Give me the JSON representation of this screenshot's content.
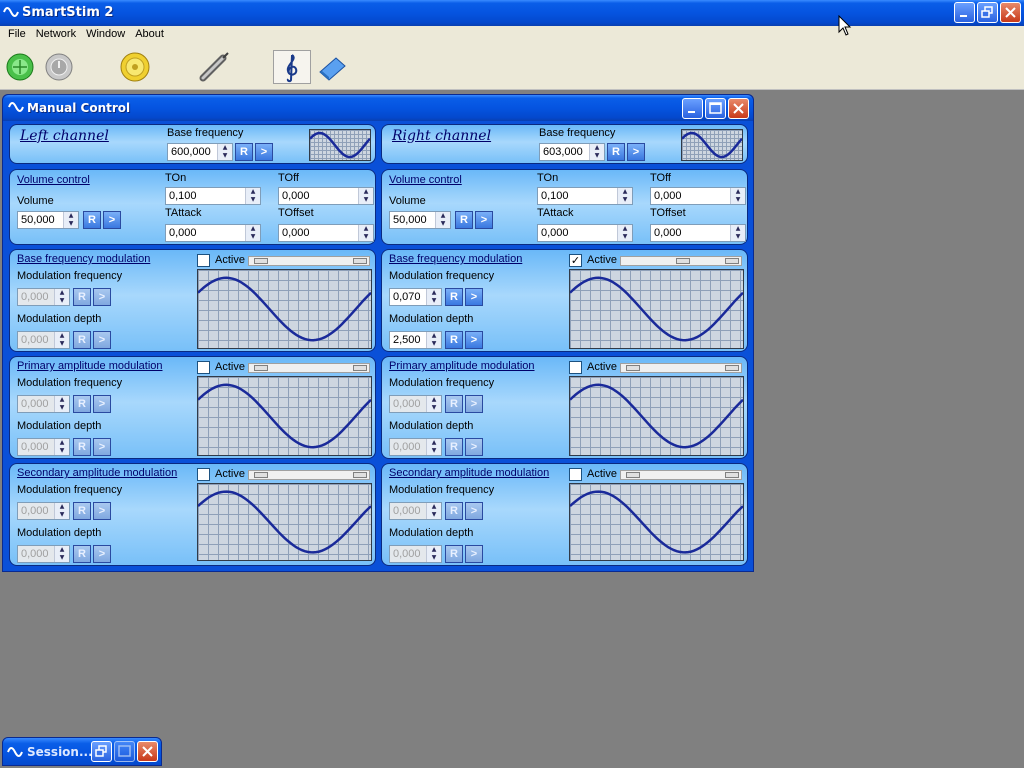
{
  "app": {
    "title": "SmartStim 2"
  },
  "menu": [
    "File",
    "Network",
    "Window",
    "About"
  ],
  "toolbar": {
    "icons": [
      "start-icon",
      "power-icon",
      "sun-dial-icon",
      "probe-icon",
      "treble-clef-icon",
      "eraser-icon"
    ],
    "pressed": "treble-clef-icon"
  },
  "manual_control": {
    "title": "Manual Control",
    "left": {
      "header": "Left channel",
      "base_frequency_label": "Base frequency",
      "base_frequency": "600,000",
      "volume_control_label": "Volume control",
      "volume_label": "Volume",
      "volume": "50,000",
      "ton_label": "TOn",
      "ton": "0,100",
      "toff_label": "TOff",
      "toff": "0,000",
      "tattack_label": "TAttack",
      "tattack": "0,000",
      "toffset_label": "TOffset",
      "toffset": "0,000",
      "mods": [
        {
          "title": "Base frequency modulation",
          "active_label": "Active",
          "active": false,
          "freq_label": "Modulation frequency",
          "freq": "0,000",
          "depth_label": "Modulation depth",
          "depth": "0,000"
        },
        {
          "title": "Primary  amplitude modulation",
          "active_label": "Active",
          "active": false,
          "freq_label": "Modulation frequency",
          "freq": "0,000",
          "depth_label": "Modulation depth",
          "depth": "0,000"
        },
        {
          "title": "Secondary amplitude modulation",
          "active_label": "Active",
          "active": false,
          "freq_label": "Modulation frequency",
          "freq": "0,000",
          "depth_label": "Modulation depth",
          "depth": "0,000"
        }
      ]
    },
    "right": {
      "header": "Right channel",
      "base_frequency_label": "Base frequency",
      "base_frequency": "603,000",
      "volume_control_label": "Volume control",
      "volume_label": "Volume",
      "volume": "50,000",
      "ton_label": "TOn",
      "ton": "0,100",
      "toff_label": "TOff",
      "toff": "0,000",
      "tattack_label": "TAttack",
      "tattack": "0,000",
      "toffset_label": "TOffset",
      "toffset": "0,000",
      "mods": [
        {
          "title": "Base frequency modulation",
          "active_label": "Active",
          "active": true,
          "freq_label": "Modulation frequency",
          "freq": "0,070",
          "depth_label": "Modulation depth",
          "depth": "2,500"
        },
        {
          "title": "Primary  amplitude modulation",
          "active_label": "Active",
          "active": false,
          "freq_label": "Modulation frequency",
          "freq": "0,000",
          "depth_label": "Modulation depth",
          "depth": "0,000"
        },
        {
          "title": "Secondary amplitude modulation",
          "active_label": "Active",
          "active": false,
          "freq_label": "Modulation frequency",
          "freq": "0,000",
          "depth_label": "Modulation depth",
          "depth": "0,000"
        }
      ]
    },
    "button_reset": "R",
    "button_apply": ">",
    "spin_up": "▲",
    "spin_down": "▼"
  },
  "session_window": {
    "title": "Session..."
  },
  "colors": {
    "titlebar": "#0554e0",
    "panel": "#a8d8fc",
    "wave": "#1a2a9a",
    "workspace": "#808080"
  }
}
